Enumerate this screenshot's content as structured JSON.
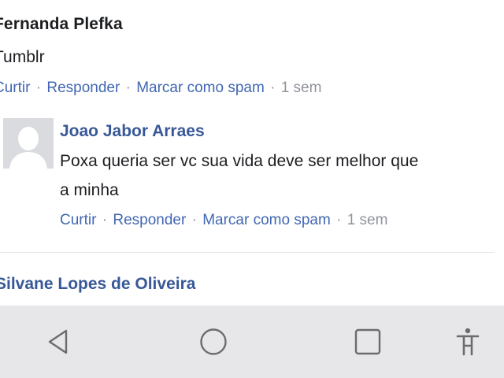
{
  "comments": {
    "top": {
      "author": "Fernanda Plefka",
      "text": "Tumblr",
      "actions": {
        "like": "Curtir",
        "reply": "Responder",
        "spam": "Marcar como spam",
        "separator": "·",
        "time": "1 sem"
      }
    },
    "reply": {
      "author": "Joao Jabor Arraes",
      "text_line1": "Poxa queria ser vc sua vida deve ser melhor que",
      "text_line2": "a minha",
      "actions": {
        "like": "Curtir",
        "reply": "Responder",
        "spam": "Marcar como spam",
        "separator": "·",
        "time": "1 sem"
      }
    },
    "next": {
      "author": "Silvane Lopes de Oliveira"
    }
  },
  "navbar": {
    "icons": [
      "back-icon",
      "home-icon",
      "recents-icon",
      "accessibility-icon"
    ],
    "icon_color": "#6b6b70",
    "background": "#e7e7ea"
  },
  "colors": {
    "link": "#4267b2",
    "author_link": "#385898",
    "meta": "#90949c",
    "text": "#1c1e21"
  }
}
